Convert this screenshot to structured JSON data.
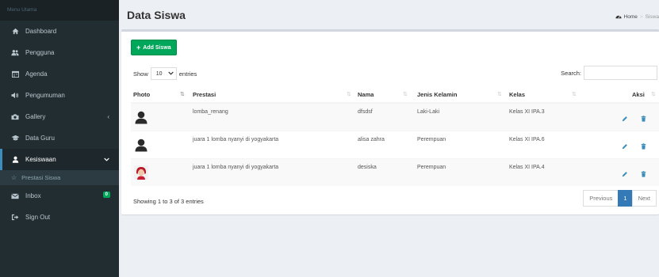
{
  "sidebar": {
    "header": "Menu Utama",
    "items": [
      {
        "label": "Dashboard",
        "icon": "home-icon"
      },
      {
        "label": "Pengguna",
        "icon": "users-icon"
      },
      {
        "label": "Agenda",
        "icon": "calendar-icon"
      },
      {
        "label": "Pengumuman",
        "icon": "volume-icon"
      },
      {
        "label": "Gallery",
        "icon": "camera-icon"
      },
      {
        "label": "Data Guru",
        "icon": "graduation-cap-icon"
      },
      {
        "label": "Kesiswaan",
        "icon": "user-icon"
      },
      {
        "label": "Inbox",
        "icon": "envelope-icon",
        "badge": "0"
      },
      {
        "label": "Sign Out",
        "icon": "sign-out-icon"
      }
    ],
    "subitem": {
      "label": "Prestasi Siswa",
      "icon": "star-icon"
    }
  },
  "page": {
    "title": "Data Siswa",
    "breadcrumb": {
      "home": "Home",
      "current": "Siswa"
    }
  },
  "toolbar": {
    "add_label": "Add Siswa"
  },
  "datatable": {
    "show_label": "Show",
    "entries_label": "entries",
    "length_value": "10",
    "search_label": "Search:",
    "columns": [
      "Photo",
      "Prestasi",
      "Nama",
      "Jenis Kelamin",
      "Kelas",
      "Aksi"
    ],
    "rows": [
      {
        "prestasi": "lomba_renang",
        "nama": "dfsdsf",
        "jk": "Laki-Laki",
        "kelas": "Kelas XI IPA.3"
      },
      {
        "prestasi": "juara 1 lomba nyanyi di yogyakarta",
        "nama": "alisa zahra",
        "jk": "Perempuan",
        "kelas": "Kelas XI IPA.6"
      },
      {
        "prestasi": "juara 1 lomba nyanyi di yogyakarta",
        "nama": "desiska",
        "jk": "Perempuan",
        "kelas": "Kelas XI IPA.4"
      }
    ],
    "info": "Showing 1 to 3 of 3 entries",
    "pagination": {
      "previous": "Previous",
      "page": "1",
      "next": "Next"
    }
  },
  "colors": {
    "sidebar_bg": "#222d32",
    "add_button": "#00a65a",
    "active_page": "#337ab7",
    "action_icon": "#3c8dbc"
  }
}
